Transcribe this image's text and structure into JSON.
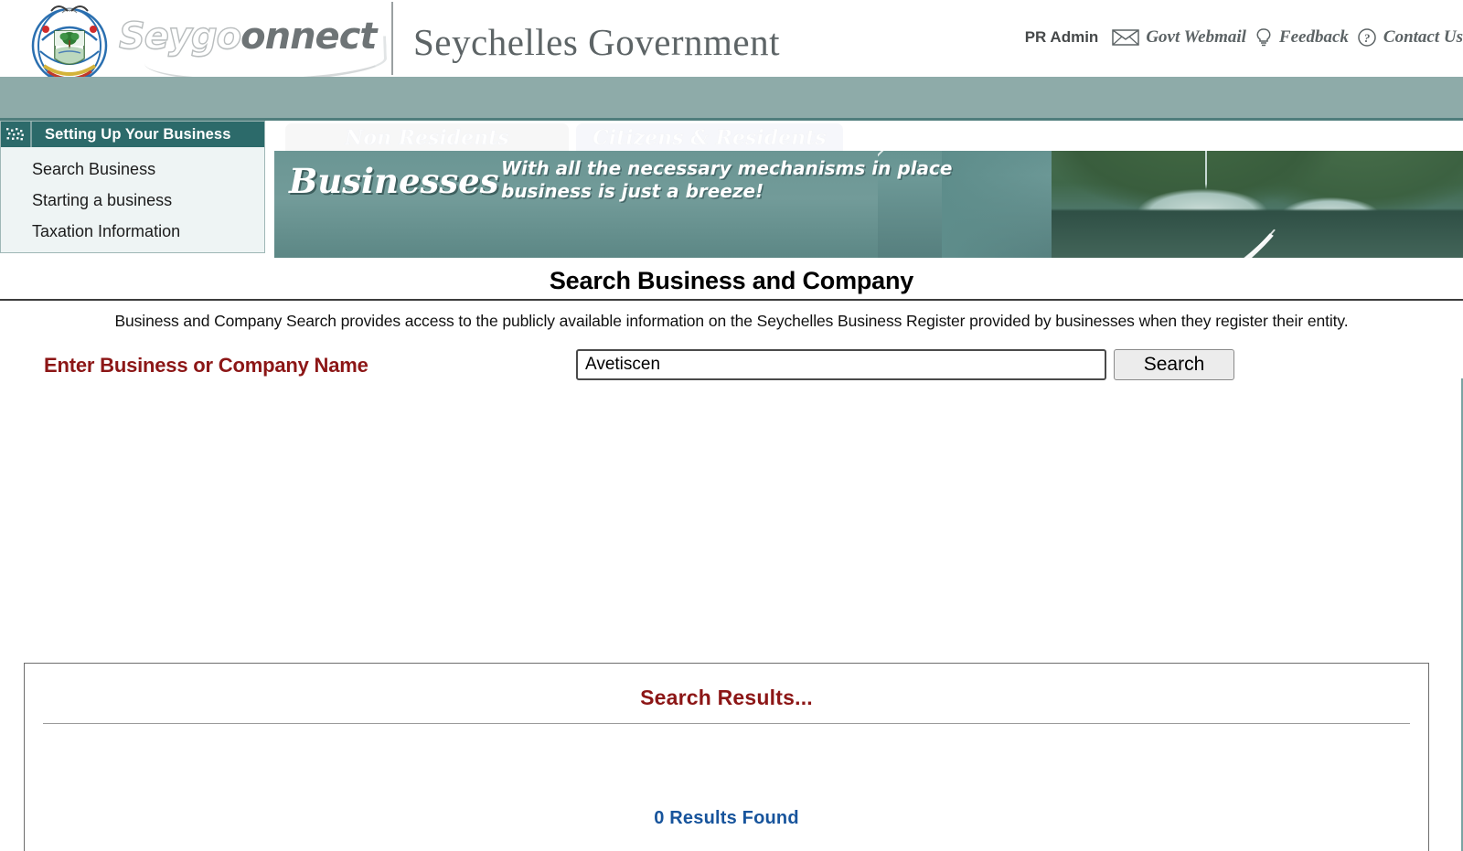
{
  "header": {
    "crest_alt": "seychelles-coat-of-arms",
    "logo_part1": "Seygo",
    "logo_part2": "onnect",
    "gov_title": "Seychelles Government",
    "user": "PR Admin",
    "links": [
      {
        "label": "Govt Webmail",
        "icon": "envelope-icon"
      },
      {
        "label": "Feedback",
        "icon": "lightbulb-icon"
      },
      {
        "label": "Contact Us",
        "icon": "question-circle-icon"
      }
    ]
  },
  "sidebar": {
    "title": "Setting Up Your Business",
    "icon": "dotted-squares-icon",
    "items": [
      {
        "label": "Search Business"
      },
      {
        "label": "Starting a business"
      },
      {
        "label": "Taxation Information"
      }
    ]
  },
  "banner": {
    "tabs": [
      {
        "label": "Non Residents"
      },
      {
        "label": "Citizens & Residents"
      }
    ],
    "word": "Businesses",
    "tagline_line1": "With all the necessary mechanisms in place",
    "tagline_line2": "business is just a breeze!",
    "photo_alt": "fishing-vessels-harbour-photo"
  },
  "main": {
    "page_title": "Search Business and Company",
    "intro": "Business and Company Search provides access to the publicly available information on the Seychelles Business Register provided by businesses when they register their entity.",
    "search_label": "Enter Business or Company Name",
    "search_value": "Avetiscen",
    "search_placeholder": "",
    "search_button": "Search",
    "results_title": "Search Results...",
    "results_count": "0 Results Found"
  },
  "colors": {
    "teal_band": "#8eaba9",
    "teal_band_border": "#4f7d7c",
    "sidebar_header": "#2c6a6a",
    "sidebar_body": "#eef4f4",
    "accent_red": "#8c1616",
    "results_blue": "#17549c",
    "banner_strip": "#6b9694"
  }
}
